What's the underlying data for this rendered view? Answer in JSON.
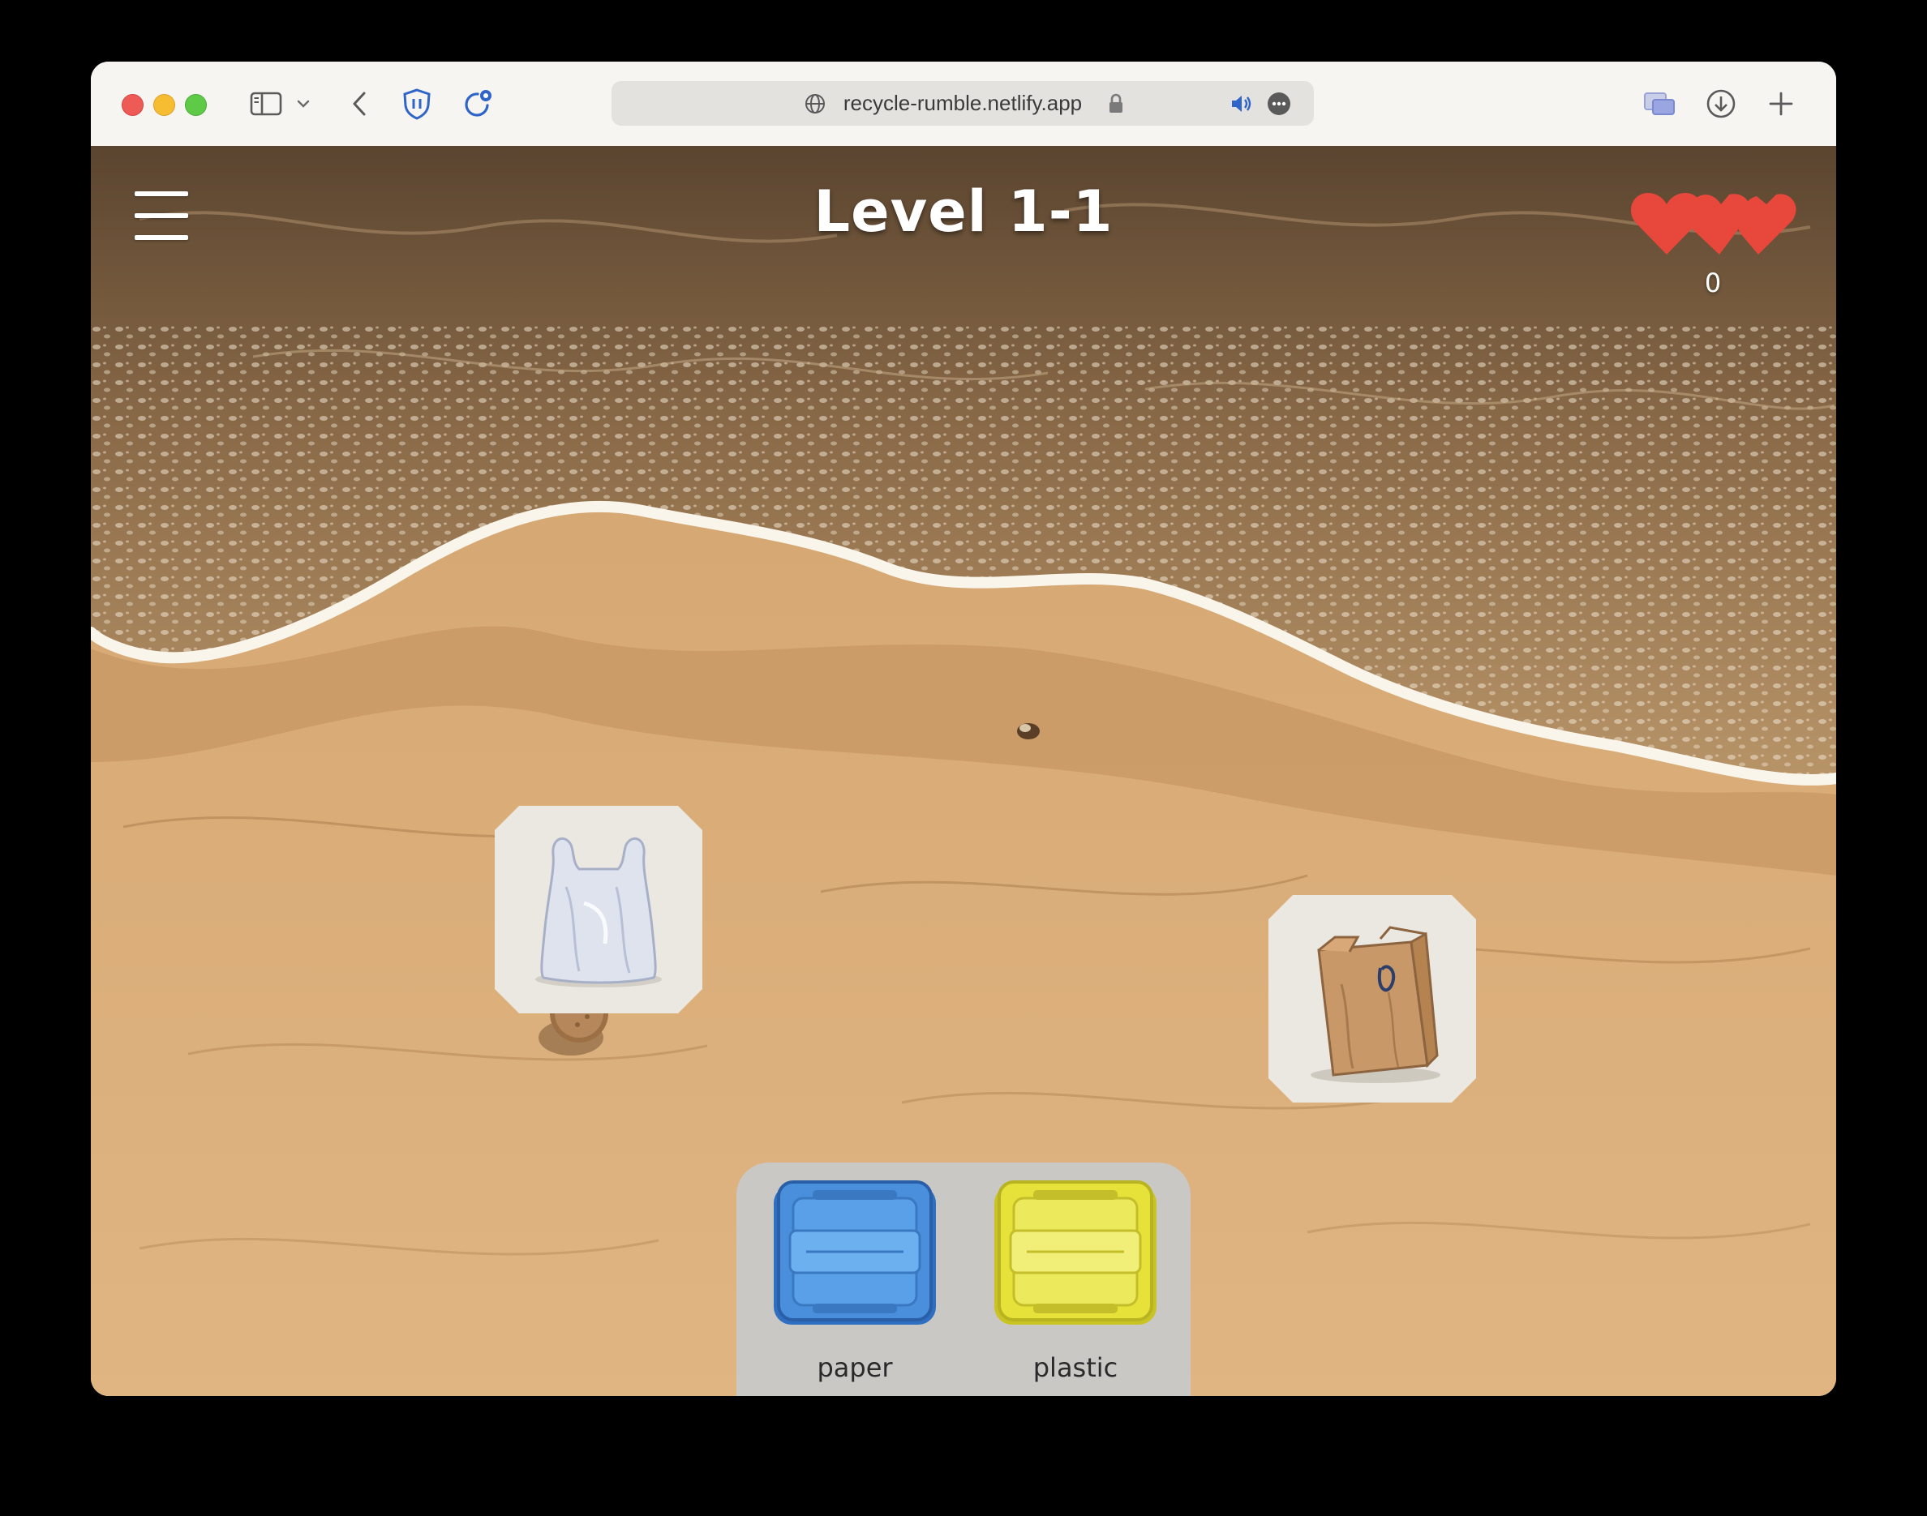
{
  "browser": {
    "url": "recycle-rumble.netlify.app",
    "icons": [
      "sidebar-icon",
      "chevron-down-icon",
      "back-icon",
      "shield-icon",
      "refresh-icon",
      "globe-icon",
      "lock-icon",
      "speaker-icon",
      "more-icon",
      "tab-overview-icon",
      "download-icon",
      "new-tab-icon"
    ]
  },
  "game": {
    "level_title": "Level 1-1",
    "lives": 3,
    "score": "0",
    "items": [
      {
        "name": "plastic bag"
      },
      {
        "name": "paper bag"
      }
    ],
    "bins": [
      {
        "label": "paper",
        "color": "#4a8fdc"
      },
      {
        "label": "plastic",
        "color": "#e6e23a"
      }
    ],
    "colors": {
      "heart": "#e8473c",
      "sand": "#dcae78",
      "water": "#7a5a3a",
      "foam": "#f4ede0"
    }
  }
}
